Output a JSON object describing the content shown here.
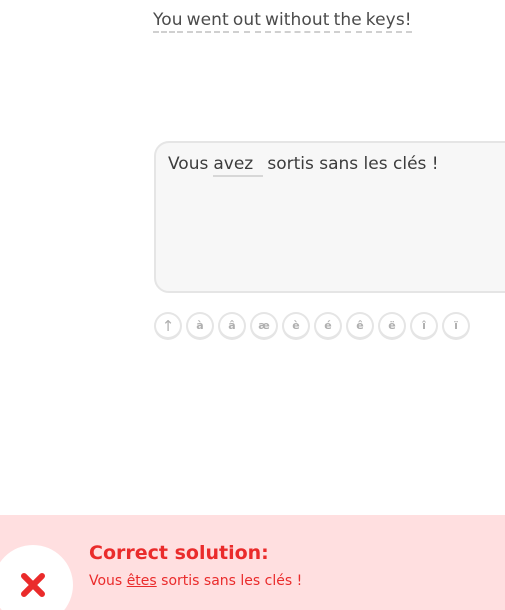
{
  "prompt": {
    "words": [
      "You",
      "went",
      "out",
      "without",
      "the",
      "keys!"
    ]
  },
  "answer": {
    "before": "Vous",
    "typed": "avez",
    "after": "sortis sans les clés !"
  },
  "keyboard": {
    "shift_glyph": "↑",
    "keys": [
      "à",
      "â",
      "æ",
      "è",
      "é",
      "ê",
      "ë",
      "î",
      "ï"
    ]
  },
  "feedback": {
    "title": "Correct solution:",
    "solution_before": "Vous",
    "solution_highlight": "êtes",
    "solution_after": "sortis sans les clés !",
    "accent_color": "#ea2b2b",
    "background_color": "#ffdfe0",
    "icon": "x-icon"
  }
}
